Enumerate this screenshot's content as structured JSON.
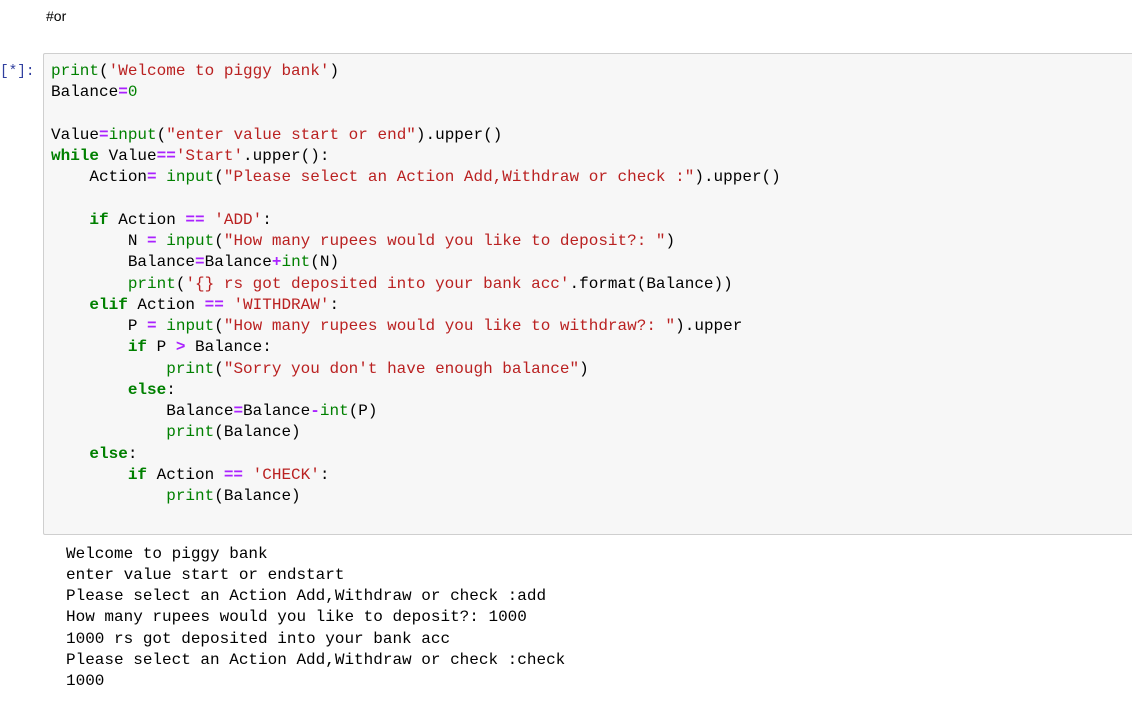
{
  "markdown_cell": {
    "text": "#or"
  },
  "code_cell": {
    "prompt": "[*]:",
    "lines": [
      [
        {
          "t": "print",
          "c": "bi"
        },
        {
          "t": "(",
          "c": ""
        },
        {
          "t": "'Welcome to piggy bank'",
          "c": "str"
        },
        {
          "t": ")",
          "c": ""
        }
      ],
      [
        {
          "t": "Balance",
          "c": ""
        },
        {
          "t": "=",
          "c": "op"
        },
        {
          "t": "0",
          "c": "num"
        }
      ],
      [],
      [
        {
          "t": "Value",
          "c": ""
        },
        {
          "t": "=",
          "c": "op"
        },
        {
          "t": "input",
          "c": "bi"
        },
        {
          "t": "(",
          "c": ""
        },
        {
          "t": "\"enter value start or end\"",
          "c": "str"
        },
        {
          "t": ").upper()",
          "c": ""
        }
      ],
      [
        {
          "t": "while",
          "c": "kw"
        },
        {
          "t": " Value",
          "c": ""
        },
        {
          "t": "==",
          "c": "op"
        },
        {
          "t": "'Start'",
          "c": "str"
        },
        {
          "t": ".upper():",
          "c": ""
        }
      ],
      [
        {
          "t": "    Action",
          "c": ""
        },
        {
          "t": "=",
          "c": "op"
        },
        {
          "t": " ",
          "c": ""
        },
        {
          "t": "input",
          "c": "bi"
        },
        {
          "t": "(",
          "c": ""
        },
        {
          "t": "\"Please select an Action Add,Withdraw or check :\"",
          "c": "str"
        },
        {
          "t": ").upper()",
          "c": ""
        }
      ],
      [],
      [
        {
          "t": "    ",
          "c": ""
        },
        {
          "t": "if",
          "c": "kw"
        },
        {
          "t": " Action ",
          "c": ""
        },
        {
          "t": "==",
          "c": "op"
        },
        {
          "t": " ",
          "c": ""
        },
        {
          "t": "'ADD'",
          "c": "str"
        },
        {
          "t": ":",
          "c": ""
        }
      ],
      [
        {
          "t": "        N ",
          "c": ""
        },
        {
          "t": "=",
          "c": "op"
        },
        {
          "t": " ",
          "c": ""
        },
        {
          "t": "input",
          "c": "bi"
        },
        {
          "t": "(",
          "c": ""
        },
        {
          "t": "\"How many rupees would you like to deposit?: \"",
          "c": "str"
        },
        {
          "t": ")",
          "c": ""
        }
      ],
      [
        {
          "t": "        Balance",
          "c": ""
        },
        {
          "t": "=",
          "c": "op"
        },
        {
          "t": "Balance",
          "c": ""
        },
        {
          "t": "+",
          "c": "op"
        },
        {
          "t": "int",
          "c": "bi"
        },
        {
          "t": "(N)",
          "c": ""
        }
      ],
      [
        {
          "t": "        ",
          "c": ""
        },
        {
          "t": "print",
          "c": "bi"
        },
        {
          "t": "(",
          "c": ""
        },
        {
          "t": "'{} rs got deposited into your bank acc'",
          "c": "str"
        },
        {
          "t": ".format(Balance))",
          "c": ""
        }
      ],
      [
        {
          "t": "    ",
          "c": ""
        },
        {
          "t": "elif",
          "c": "kw"
        },
        {
          "t": " Action ",
          "c": ""
        },
        {
          "t": "==",
          "c": "op"
        },
        {
          "t": " ",
          "c": ""
        },
        {
          "t": "'WITHDRAW'",
          "c": "str"
        },
        {
          "t": ":",
          "c": ""
        }
      ],
      [
        {
          "t": "        P ",
          "c": ""
        },
        {
          "t": "=",
          "c": "op"
        },
        {
          "t": " ",
          "c": ""
        },
        {
          "t": "input",
          "c": "bi"
        },
        {
          "t": "(",
          "c": ""
        },
        {
          "t": "\"How many rupees would you like to withdraw?: \"",
          "c": "str"
        },
        {
          "t": ").upper",
          "c": ""
        }
      ],
      [
        {
          "t": "        ",
          "c": ""
        },
        {
          "t": "if",
          "c": "kw"
        },
        {
          "t": " P ",
          "c": ""
        },
        {
          "t": ">",
          "c": "op"
        },
        {
          "t": " Balance:",
          "c": ""
        }
      ],
      [
        {
          "t": "            ",
          "c": ""
        },
        {
          "t": "print",
          "c": "bi"
        },
        {
          "t": "(",
          "c": ""
        },
        {
          "t": "\"Sorry you don't have enough balance\"",
          "c": "str"
        },
        {
          "t": ")",
          "c": ""
        }
      ],
      [
        {
          "t": "        ",
          "c": ""
        },
        {
          "t": "else",
          "c": "kw"
        },
        {
          "t": ":",
          "c": ""
        }
      ],
      [
        {
          "t": "            Balance",
          "c": ""
        },
        {
          "t": "=",
          "c": "op"
        },
        {
          "t": "Balance",
          "c": ""
        },
        {
          "t": "-",
          "c": "op"
        },
        {
          "t": "int",
          "c": "bi"
        },
        {
          "t": "(P)",
          "c": ""
        }
      ],
      [
        {
          "t": "            ",
          "c": ""
        },
        {
          "t": "print",
          "c": "bi"
        },
        {
          "t": "(Balance)",
          "c": ""
        }
      ],
      [
        {
          "t": "    ",
          "c": ""
        },
        {
          "t": "else",
          "c": "kw"
        },
        {
          "t": ":",
          "c": ""
        }
      ],
      [
        {
          "t": "        ",
          "c": ""
        },
        {
          "t": "if",
          "c": "kw"
        },
        {
          "t": " Action ",
          "c": ""
        },
        {
          "t": "==",
          "c": "op"
        },
        {
          "t": " ",
          "c": ""
        },
        {
          "t": "'CHECK'",
          "c": "str"
        },
        {
          "t": ":",
          "c": ""
        }
      ],
      [
        {
          "t": "            ",
          "c": ""
        },
        {
          "t": "print",
          "c": "bi"
        },
        {
          "t": "(Balance)",
          "c": ""
        }
      ]
    ]
  },
  "output": {
    "lines": [
      "Welcome to piggy bank",
      "enter value start or endstart",
      "Please select an Action Add,Withdraw or check :add",
      "How many rupees would you like to deposit?: 1000",
      "1000 rs got deposited into your bank acc",
      "Please select an Action Add,Withdraw or check :check",
      "1000"
    ]
  }
}
